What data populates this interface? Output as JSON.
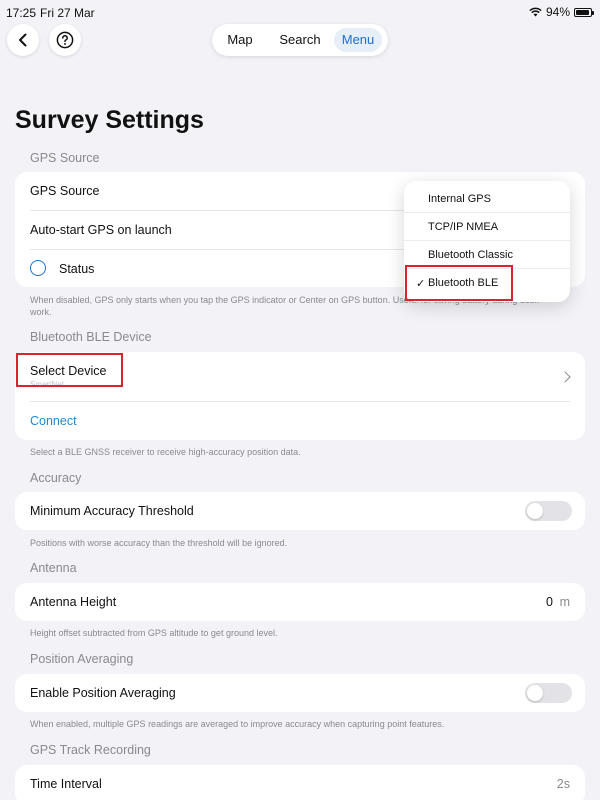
{
  "status_bar": {
    "time": "17:25",
    "date": "Fri 27 Mar",
    "battery_text": "94%",
    "battery_level": 0.94
  },
  "nav": {
    "back_icon": "chevron-left-icon",
    "help_icon": "question-circle-icon",
    "tabs": [
      {
        "label": "Map",
        "selected": false
      },
      {
        "label": "Search",
        "selected": false
      },
      {
        "label": "Menu",
        "selected": true
      }
    ]
  },
  "page_title": "Survey Settings",
  "sections": {
    "gps_source": {
      "header": "GPS Source",
      "rows": {
        "source_label": "GPS Source",
        "autostart_label": "Auto-start GPS on launch",
        "status_label": "Status"
      },
      "footer": "When disabled, GPS only starts when you tap the GPS indicator or Center on GPS button. Useful for saving battery during desk work."
    },
    "bluetooth": {
      "header": "Bluetooth BLE Device",
      "select_label": "Select Device",
      "select_sublabel": "SmartNet",
      "connect_label": "Connect",
      "footer": "Select a BLE GNSS receiver to receive high-accuracy position data."
    },
    "accuracy": {
      "header": "Accuracy",
      "row_label": "Minimum Accuracy Threshold",
      "toggle_on": false,
      "footer": "Positions with worse accuracy than the threshold will be ignored."
    },
    "antenna": {
      "header": "Antenna",
      "row_label": "Antenna Height",
      "value": "0",
      "unit": "m",
      "footer": "Height offset subtracted from GPS altitude to get ground level."
    },
    "averaging": {
      "header": "Position Averaging",
      "row_label": "Enable Position Averaging",
      "toggle_on": false,
      "footer": "When enabled, multiple GPS readings are averaged to improve accuracy when capturing point features."
    },
    "track": {
      "header": "GPS Track Recording",
      "row_label": "Time Interval",
      "value": "2s"
    }
  },
  "dropdown": {
    "options": [
      "Internal GPS",
      "TCP/IP NMEA",
      "Bluetooth Classic",
      "Bluetooth BLE"
    ],
    "selected": "Bluetooth BLE",
    "check_mark": "✓"
  },
  "colors": {
    "accent": "#1e6fd0",
    "link": "#1e8ad0",
    "highlight": "#d9232e",
    "background": "#f2f2f7"
  }
}
